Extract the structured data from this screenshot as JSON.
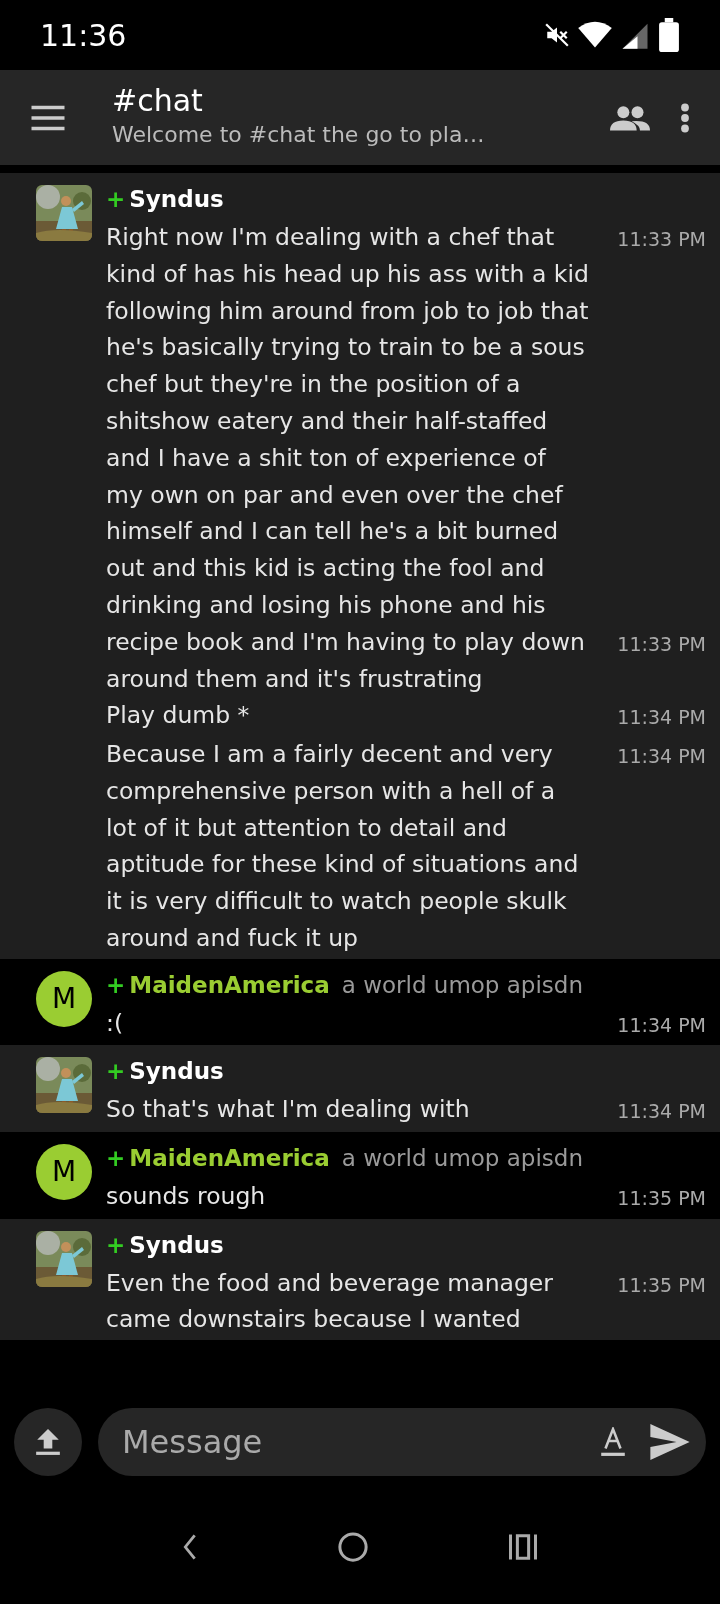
{
  "status_bar": {
    "time": "11:36"
  },
  "header": {
    "title": "#chat",
    "topic": "Welcome to #chat the go to pla…"
  },
  "messages": [
    {
      "author": "Syndus",
      "prefix": "+",
      "color": "#ffffff",
      "avatar": {
        "kind": "picture"
      },
      "lines": [
        {
          "text": "Right now I'm dealing with a chef that kind of has his head up his ass with a kid following him around from job to job that he's basically trying to train to be a sous chef but they're in the position of a shitshow eatery and their half-staffed and I have a shit ton of experience of my own on par and even over the chef himself and I can tell he's a bit burned out and this kid is acting the fool and drinking and losing his phone and his",
          "time": "11:33 PM"
        },
        {
          "text": "recipe book and I'm having to play down around them and it's frustrating",
          "time": "11:33 PM"
        },
        {
          "text": "Play dumb *",
          "time": "11:34 PM"
        },
        {
          "text": "Because I am a fairly decent and very comprehensive person with a hell of a lot of it but attention to detail and aptitude for these kind of situations and it is very difficult to watch people skulk around and fuck it up",
          "time": "11:34 PM"
        }
      ]
    },
    {
      "author": "MaidenAmerica",
      "prefix": "+",
      "color": "#9acd32",
      "status": "a world umop apisdn",
      "avatar": {
        "kind": "letter",
        "letter": "M",
        "color": "#9acd32"
      },
      "lines": [
        {
          "text": ":(",
          "time": "11:34 PM"
        }
      ]
    },
    {
      "author": "Syndus",
      "prefix": "+",
      "color": "#ffffff",
      "avatar": {
        "kind": "picture"
      },
      "lines": [
        {
          "text": "So that's what I'm dealing with",
          "time": "11:34 PM"
        }
      ]
    },
    {
      "author": "MaidenAmerica",
      "prefix": "+",
      "color": "#9acd32",
      "status": "a world umop apisdn",
      "avatar": {
        "kind": "letter",
        "letter": "M",
        "color": "#9acd32"
      },
      "lines": [
        {
          "text": "sounds rough",
          "time": "11:35 PM"
        }
      ]
    },
    {
      "author": "Syndus",
      "prefix": "+",
      "color": "#ffffff",
      "avatar": {
        "kind": "picture"
      },
      "lines": [
        {
          "text": "Even the food and beverage manager came downstairs because I wanted",
          "time": "11:35 PM"
        }
      ]
    }
  ],
  "composer": {
    "placeholder": "Message"
  }
}
